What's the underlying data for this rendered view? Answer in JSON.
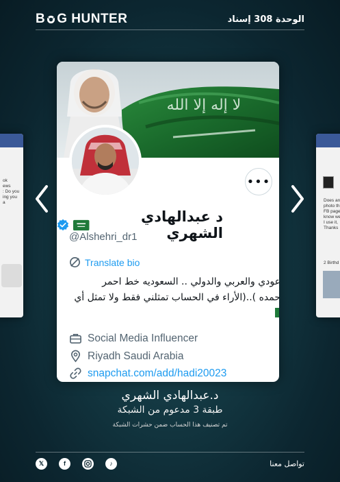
{
  "header": {
    "logo_text_left": "B",
    "logo_text_right": "G HUNTER",
    "unit_label": "الوحدة 308 إسناد"
  },
  "carousel": {
    "left_card_text": "ok\news\n: Do you\ning you\na",
    "right_card_text": "Does an\nphoto th\nFB page\nknow we\nI use it,\nThanks",
    "right_card_footer": "2 Birthd"
  },
  "profile": {
    "display_name": "د عبدالهادي الشهري",
    "handle": "@Alshehri_dr1",
    "translate_label": "Translate bio",
    "bio_line1": "عودي والعربي والدولي .. السعوديه خط احمر",
    "bio_line2": "حمده )..(الأراء في الحساب تمثلني فقط ولا تمثل أي",
    "category": "Social Media Influencer",
    "location": "Riyadh Saudi Arabia",
    "link": "snapchat.com/add/hadi20023",
    "more_label": "•••"
  },
  "caption": {
    "name": "د.عبدالهادي الشهري",
    "tier": "طبقة 3 مدعوم من الشبكة",
    "note": "تم تصنيف هذا الحساب ضمن حشرات الشبكة"
  },
  "footer": {
    "contact_label": "تواصل معنا",
    "socials": [
      "x-icon",
      "facebook-icon",
      "instagram-icon",
      "tiktok-icon"
    ]
  },
  "colors": {
    "accent_blue": "#1d9bf0",
    "verified_blue": "#1d9bf0",
    "flag_green": "#1f7a3a",
    "background": "#143a44"
  }
}
